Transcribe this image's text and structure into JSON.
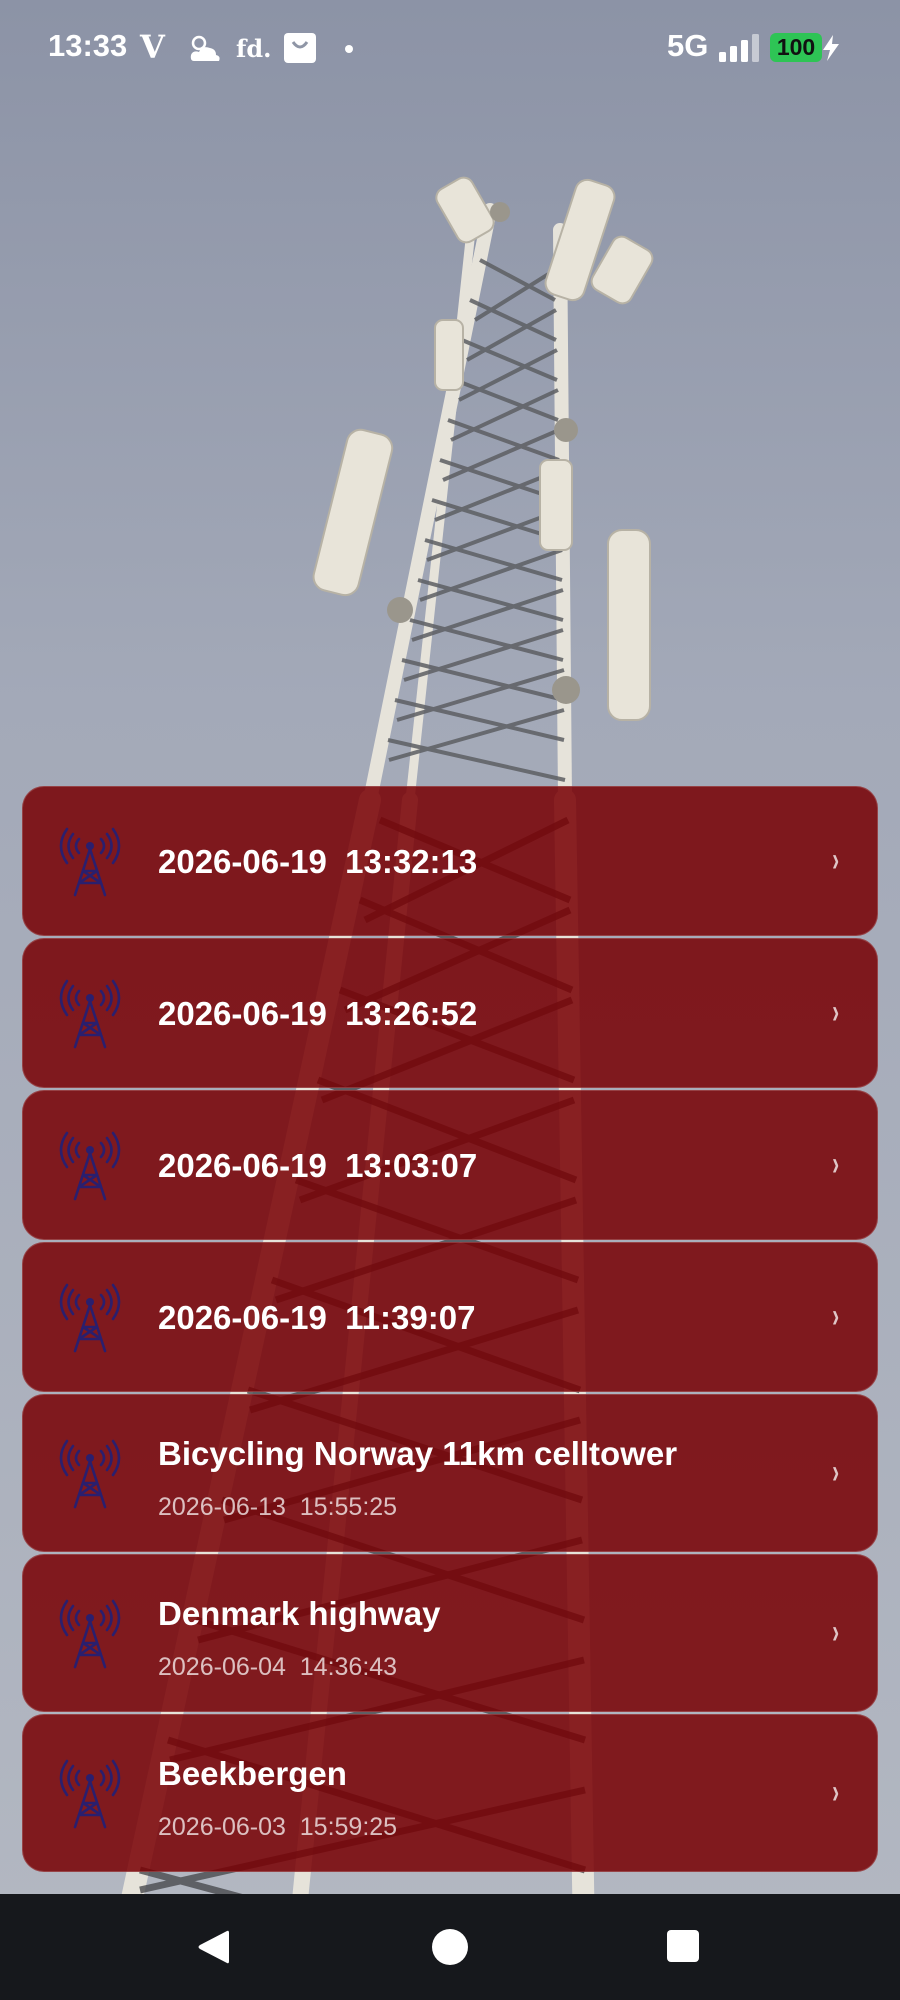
{
  "status_bar": {
    "time": "13:33",
    "notif_icons": [
      "vivaldi-icon",
      "weather-icon",
      "fd-icon",
      "shopping-bag-icon",
      "dot-icon"
    ],
    "v_glyph": "V",
    "fd_glyph": "fd.",
    "network": "5G",
    "battery": "100",
    "battery_color": "#2ec455"
  },
  "entries": [
    {
      "title": "2026-06-19  13:32:13",
      "subtitle": ""
    },
    {
      "title": "2026-06-19  13:26:52",
      "subtitle": ""
    },
    {
      "title": "2026-06-19  13:03:07",
      "subtitle": ""
    },
    {
      "title": "2026-06-19  11:39:07",
      "subtitle": ""
    },
    {
      "title": "Bicycling Norway 11km celltower",
      "subtitle": "2026-06-13  15:55:25"
    },
    {
      "title": "Denmark highway",
      "subtitle": "2026-06-04  14:36:43"
    },
    {
      "title": "Beekbergen",
      "subtitle": "2026-06-03  15:59:25"
    }
  ],
  "row_chevron": "›",
  "row_icon": "cell-tower-icon",
  "colors": {
    "row_bg": "#7a0004",
    "icon": "#2a1f6e",
    "nav_bg": "#16181c"
  },
  "nav": [
    "back-icon",
    "home-icon",
    "recents-icon"
  ]
}
